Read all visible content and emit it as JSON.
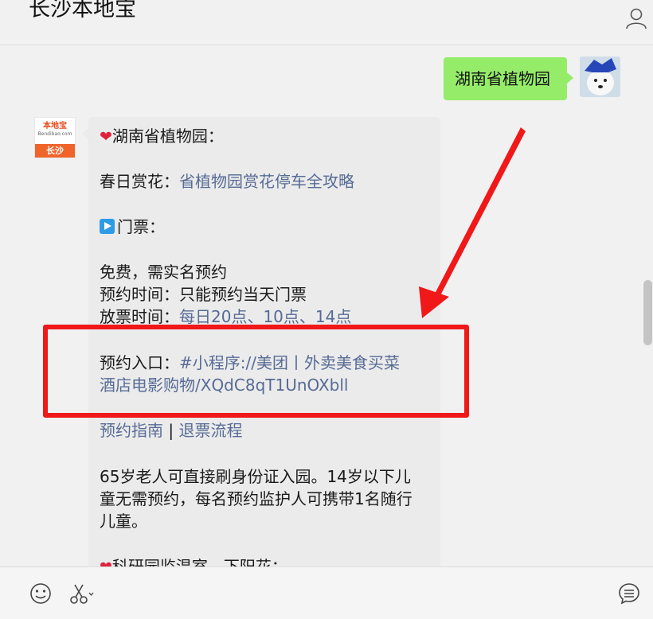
{
  "header": {
    "title": "长沙本地宝",
    "profile_icon": "person-icon"
  },
  "chat": {
    "my_message": "湖南省植物园",
    "bot_avatar": {
      "logo_text": "本地宝",
      "logo_url": "Bendibao.com",
      "city": "长沙"
    },
    "bubble": {
      "heading": "湖南省植物园：",
      "spring_label": "春日赏花：",
      "spring_link": "省植物园赏花停车全攻略",
      "ticket_heading": "门票：",
      "free": "免费，需实名预约",
      "reserve_time": "预约时间：只能预约当天门票",
      "release_label": "放票时间：",
      "release_link": "每日20点、10点、14点",
      "entry_label": "预约入口：",
      "entry_link_1": "#小程序://美团丨外卖美食买菜",
      "entry_link_2": "酒店电影购物/XQdC8qT1UnOXbll",
      "guide_link": "预约指南",
      "separator": " | ",
      "refund_link": "退票流程",
      "elder_1": "65岁老人可直接刷身份证入园。14岁以下儿",
      "elder_2": "童无需预约，每名预约监护人可携带1名随行",
      "elder_3": "儿童。",
      "next_heading": "科研园监温室、下阳花："
    }
  },
  "input_bar": {
    "emoji_icon": "smiley-icon",
    "scissors_icon": "scissors-icon",
    "history_icon": "chat-history-icon"
  },
  "colors": {
    "accent_green": "#95ec69",
    "link": "#576b95",
    "highlight_red": "#f01818"
  }
}
